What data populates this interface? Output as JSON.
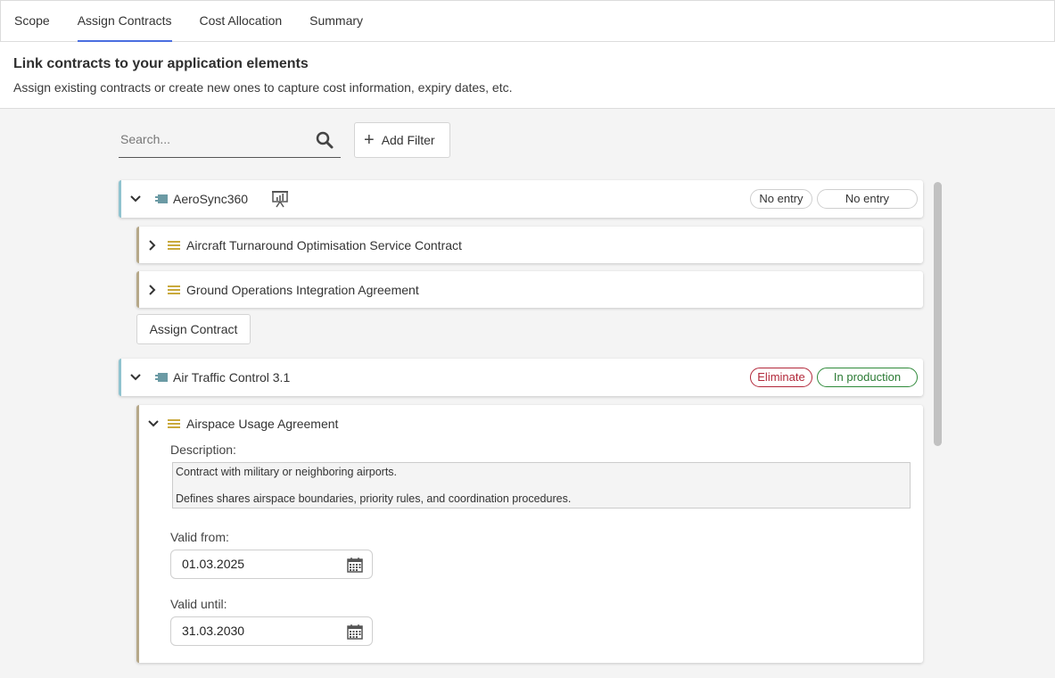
{
  "tabs": [
    {
      "label": "Scope"
    },
    {
      "label": "Assign Contracts"
    },
    {
      "label": "Cost Allocation"
    },
    {
      "label": "Summary"
    }
  ],
  "header": {
    "title": "Link contracts to your application elements",
    "subtitle": "Assign existing contracts or create new ones to capture cost information, expiry dates, etc."
  },
  "search": {
    "placeholder": "Search..."
  },
  "add_filter_label": "Add Filter",
  "applications": [
    {
      "name": "AeroSync360",
      "badges": [
        "No entry",
        "No entry"
      ],
      "contracts": [
        {
          "name": "Aircraft Turnaround Optimisation Service Contract"
        },
        {
          "name": "Ground Operations Integration Agreement"
        }
      ],
      "assign_label": "Assign Contract"
    },
    {
      "name": "Air Traffic Control 3.1",
      "badges": [
        "Eliminate",
        "In production"
      ],
      "badge_colors": [
        "#b2283a",
        "#2f8a3a"
      ],
      "contracts": [
        {
          "name": "Airspace Usage Agreement",
          "description_label": "Description:",
          "description_lines": [
            "Contract with military or neighboring airports.",
            "Defines shares airspace boundaries, priority rules, and coordination procedures."
          ],
          "valid_from_label": "Valid from:",
          "valid_from": "01.03.2025",
          "valid_until_label": "Valid until:",
          "valid_until": "31.03.2030"
        }
      ]
    }
  ],
  "colors": {
    "accent": "#4a6ee0",
    "app_border": "#8fc3cf",
    "contract_border": "#b6a889",
    "contract_icon": "#c9a93c",
    "app_icon": "#5d8a94"
  }
}
